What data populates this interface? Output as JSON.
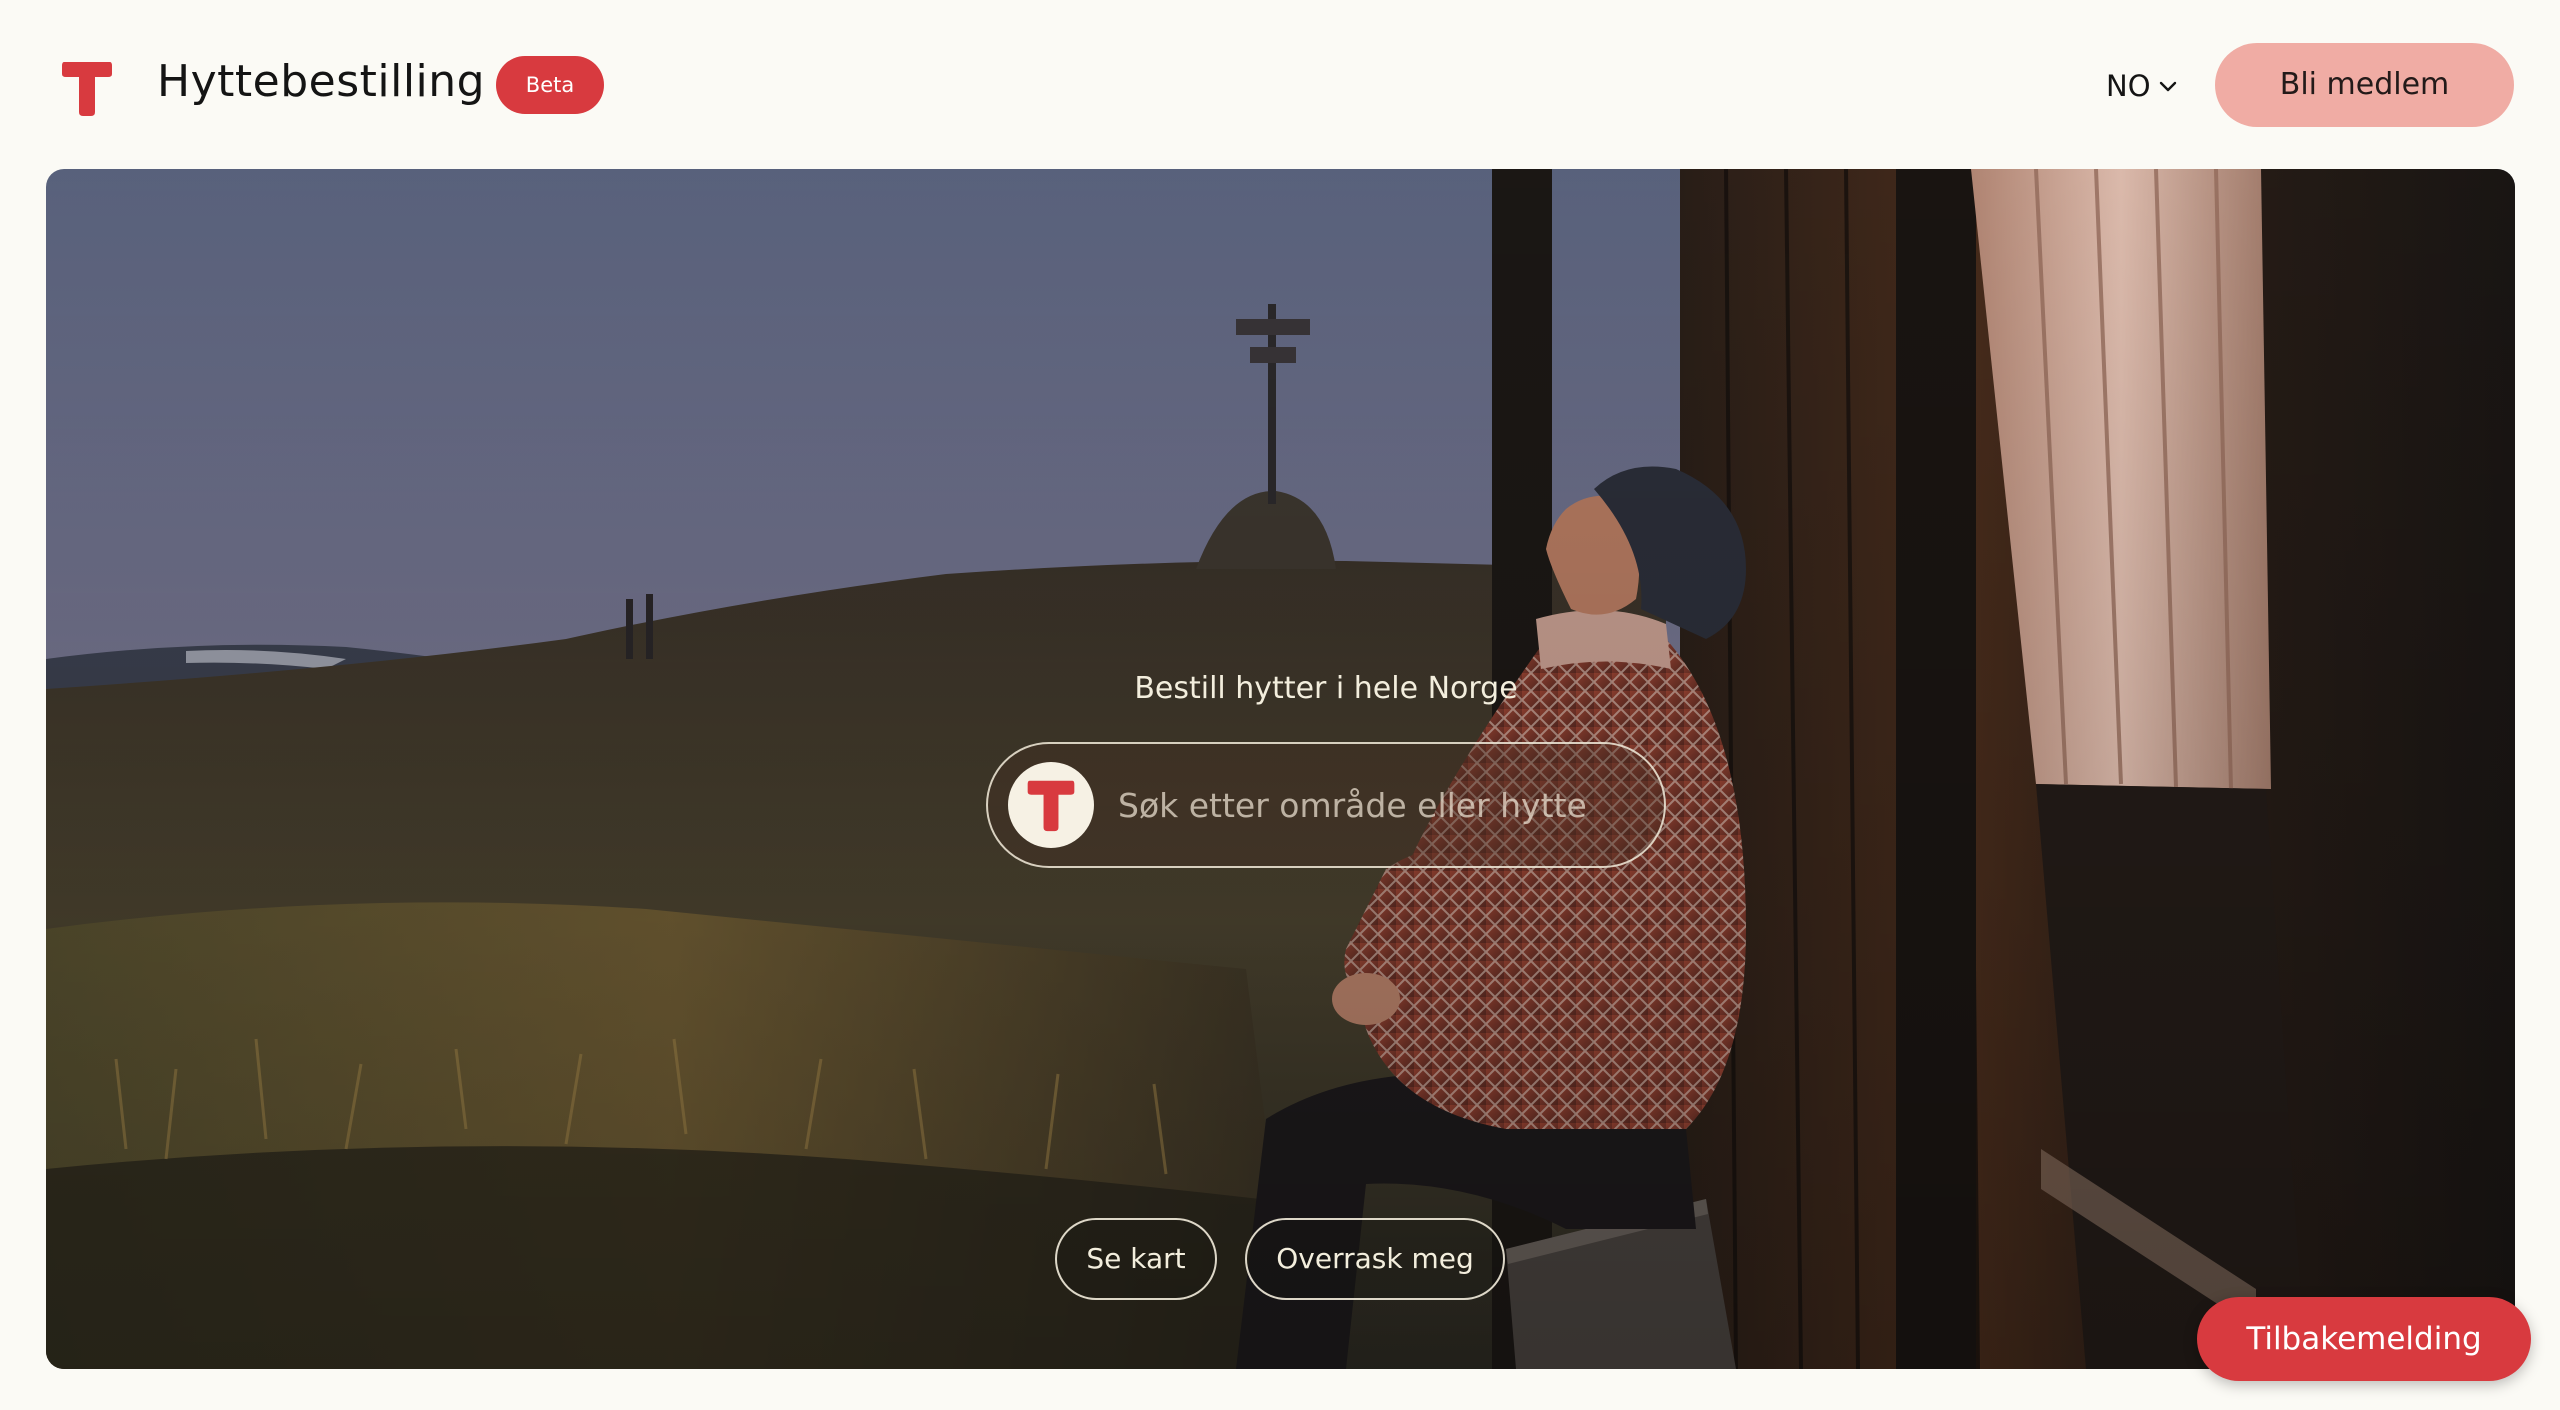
{
  "header": {
    "logo_icon": "dnt-t-logo-icon",
    "title": "Hyttebestilling",
    "badge": "Beta",
    "language": {
      "selected": "NO",
      "icon": "chevron-down-icon"
    },
    "join_label": "Bli medlem"
  },
  "hero": {
    "heading": "Bestill hytter i hele Norge",
    "search": {
      "icon": "dnt-t-logo-icon",
      "placeholder": "Søk etter område eller hytte",
      "value": ""
    },
    "buttons": {
      "map_label": "Se kart",
      "surprise_label": "Overrask meg"
    }
  },
  "feedback_label": "Tilbakemelding",
  "colors": {
    "brand_red": "#d83a3f",
    "join_button_pink": "#f0aca4",
    "page_background": "#fbfaf5"
  }
}
